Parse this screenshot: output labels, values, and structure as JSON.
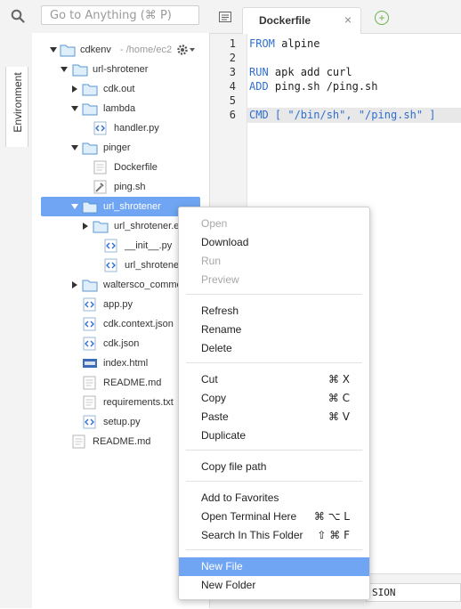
{
  "search": {
    "placeholder": "Go to Anything (⌘ P)"
  },
  "sidebar": {
    "tab_label": "Environment"
  },
  "tree": {
    "root": {
      "name": "cdkenv",
      "path": "- /home/ec2"
    },
    "items": [
      {
        "name": "url-shrotener"
      },
      {
        "name": "cdk.out"
      },
      {
        "name": "lambda"
      },
      {
        "name": "handler.py"
      },
      {
        "name": "pinger"
      },
      {
        "name": "Dockerfile"
      },
      {
        "name": "ping.sh"
      },
      {
        "name": "url_shrotener"
      },
      {
        "name": "url_shrotener.e"
      },
      {
        "name": "__init__.py"
      },
      {
        "name": "url_shrotener_"
      },
      {
        "name": "waltersco_comme"
      },
      {
        "name": "app.py"
      },
      {
        "name": "cdk.context.json"
      },
      {
        "name": "cdk.json"
      },
      {
        "name": "index.html"
      },
      {
        "name": "README.md"
      },
      {
        "name": "requirements.txt"
      },
      {
        "name": "setup.py"
      },
      {
        "name": "README.md"
      }
    ]
  },
  "editor": {
    "tab_title": "Dockerfile",
    "lines": [
      {
        "num": "1",
        "kw": "FROM",
        "rest": " alpine"
      },
      {
        "num": "2",
        "kw": "",
        "rest": ""
      },
      {
        "num": "3",
        "kw": "RUN",
        "rest": " apk add curl"
      },
      {
        "num": "4",
        "kw": "ADD",
        "rest": " ping.sh /ping.sh"
      },
      {
        "num": "5",
        "kw": "",
        "rest": ""
      },
      {
        "num": "6",
        "kw": "CMD",
        "rest": " [ \"/bin/sh\", \"/ping.sh\" ]"
      }
    ],
    "bottom_text": "SION"
  },
  "context_menu": {
    "open": "Open",
    "download": "Download",
    "run": "Run",
    "preview": "Preview",
    "refresh": "Refresh",
    "rename": "Rename",
    "delete": "Delete",
    "cut": "Cut",
    "cut_sc": "⌘ X",
    "copy": "Copy",
    "copy_sc": "⌘ C",
    "paste": "Paste",
    "paste_sc": "⌘ V",
    "duplicate": "Duplicate",
    "copy_path": "Copy file path",
    "add_favorites": "Add to Favorites",
    "open_terminal": "Open Terminal Here",
    "open_terminal_sc": "⌘ ⌥ L",
    "search_folder": "Search In This Folder",
    "search_folder_sc": "⇧ ⌘ F",
    "new_file": "New File",
    "new_folder": "New Folder"
  }
}
